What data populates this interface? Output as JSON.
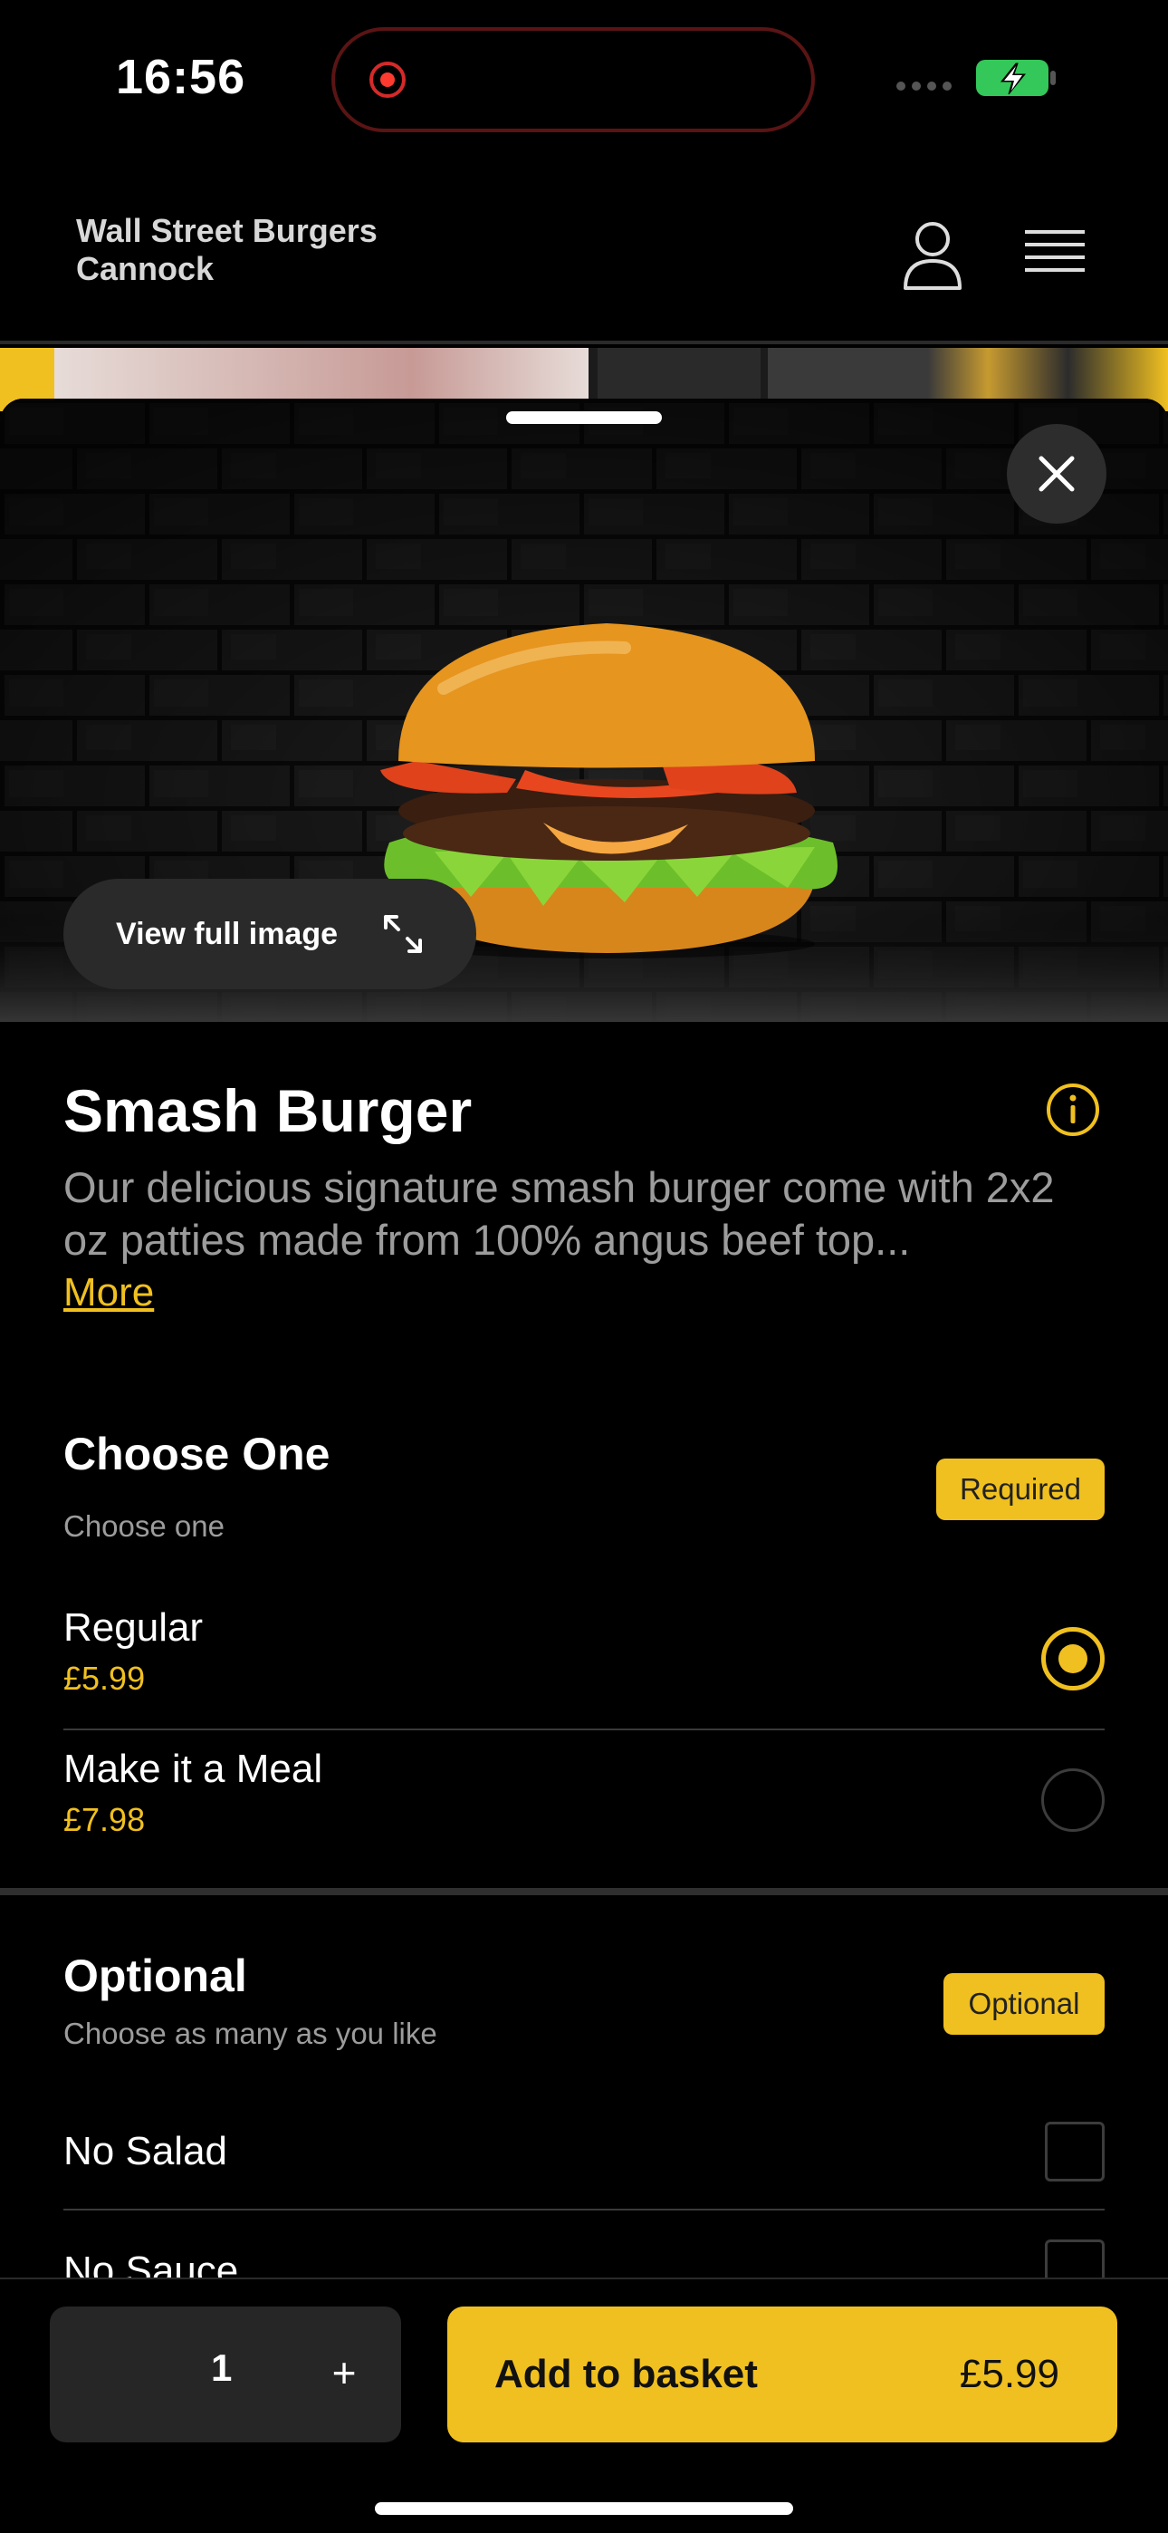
{
  "status_bar": {
    "time": "16:56"
  },
  "header": {
    "restaurant_name": "Wall Street Burgers Cannock"
  },
  "product": {
    "view_full_image_label": "View full image",
    "title": "Smash Burger",
    "description": "Our delicious signature smash burger come with 2x2 oz patties made from 100% angus beef top...",
    "more_label": "More"
  },
  "groups": [
    {
      "title": "Choose One",
      "subtitle": "Choose one",
      "badge": "Required",
      "options": [
        {
          "name": "Regular",
          "price": "£5.99",
          "selected": true
        },
        {
          "name": "Make it a Meal",
          "price": "£7.98",
          "selected": false
        }
      ]
    },
    {
      "title": "Optional",
      "subtitle": "Choose as many as you like",
      "badge": "Optional",
      "options": [
        {
          "name": "No Salad",
          "checked": false
        },
        {
          "name": "No Sauce",
          "checked": false
        }
      ]
    }
  ],
  "basket": {
    "quantity": "1",
    "plus_symbol": "+",
    "add_label": "Add to basket",
    "price": "£5.99"
  },
  "colors": {
    "accent": "#f0c020",
    "background": "#000000",
    "muted_text": "#9c9c9c"
  },
  "icons": [
    "record-icon",
    "signal-icon",
    "battery-charging-icon",
    "user-icon",
    "hamburger-menu-icon",
    "close-icon",
    "expand-icon",
    "info-icon"
  ]
}
